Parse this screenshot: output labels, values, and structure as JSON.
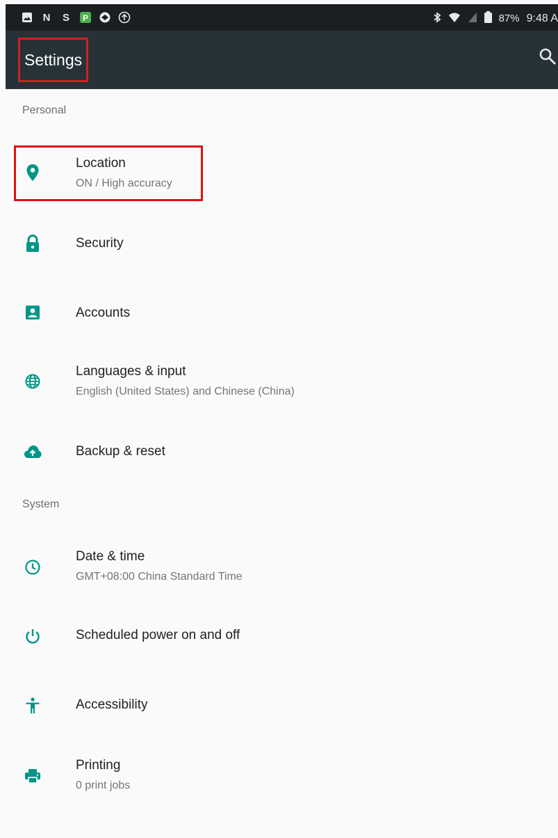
{
  "status_bar": {
    "left_icons": [
      "gallery-icon",
      "n-icon",
      "s-icon",
      "p-icon",
      "vpn-icon",
      "upload-icon"
    ],
    "battery_percent": "87%",
    "time": "9:48 A"
  },
  "toolbar": {
    "title": "Settings",
    "search_icon": "search-icon"
  },
  "sections": {
    "personal": "Personal",
    "system": "System"
  },
  "items": [
    {
      "icon": "location-pin-icon",
      "title": "Location",
      "subtitle": "ON / High accuracy"
    },
    {
      "icon": "lock-icon",
      "title": "Security"
    },
    {
      "icon": "account-icon",
      "title": "Accounts"
    },
    {
      "icon": "globe-icon",
      "title": "Languages & input",
      "subtitle": "English (United States) and Chinese (China)"
    },
    {
      "icon": "cloud-upload-icon",
      "title": "Backup & reset"
    },
    {
      "icon": "clock-icon",
      "title": "Date & time",
      "subtitle": "GMT+08:00 China Standard Time"
    },
    {
      "icon": "power-icon",
      "title": "Scheduled power on and off"
    },
    {
      "icon": "accessibility-icon",
      "title": "Accessibility"
    },
    {
      "icon": "printer-icon",
      "title": "Printing",
      "subtitle": "0 print jobs"
    }
  ],
  "colors": {
    "accent": "#009688",
    "toolbar": "#263238",
    "highlight": "#e01010"
  }
}
